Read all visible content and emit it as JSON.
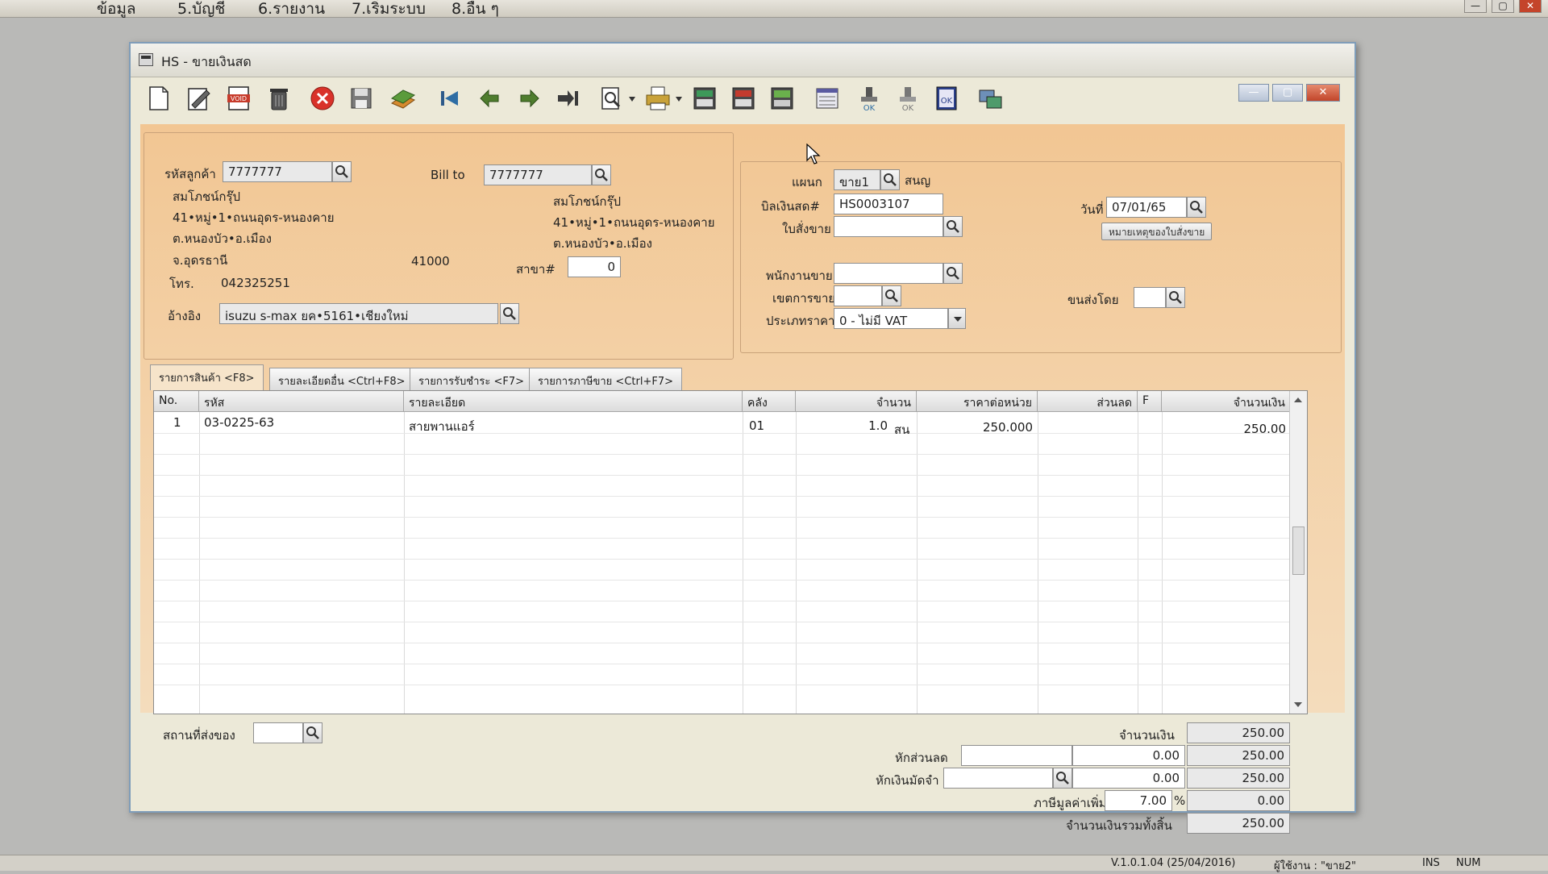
{
  "menubar": {
    "items": [
      "ข้อมูล",
      "5.บัญชี",
      "6.รายงาน",
      "7.เริ่มระบบ",
      "8.อื่น ๆ"
    ]
  },
  "window": {
    "title": "HS - ขายเงินสด"
  },
  "colors": {
    "header_bg": "#f2c693",
    "field_bg": "#ffffff",
    "close_button": "#c2452a"
  },
  "customer": {
    "code_label": "รหัสลูกค้า",
    "code": "7777777",
    "name": "สมโภชน์กรุ๊ป",
    "address1": "41•หมู่•1•ถนนอุดร-หนองคาย",
    "address2": "ต.หนองบัว•อ.เมือง",
    "province": "จ.อุดรธานี",
    "postcode": "41000",
    "phone_label": "โทร.",
    "phone": "042325251",
    "ref_label": "อ้างอิง",
    "ref": "isuzu s-max ยค•5161•เชียงใหม่"
  },
  "billto": {
    "label": "Bill to",
    "code": "7777777",
    "name": "สมโภชน์กรุ๊ป",
    "address1": "41•หมู่•1•ถนนอุดร-หนองคาย",
    "address2": "ต.หนองบัว•อ.เมือง",
    "branch_label": "สาขา#",
    "branch": "0"
  },
  "doc": {
    "dept_label": "แผนก",
    "dept": "ขาย1",
    "dept_name": "สนญ",
    "bill_label": "บิลเงินสด#",
    "bill": "HS0003107",
    "date_label": "วันที่",
    "date": "07/01/65",
    "order_label": "ใบสั่งขาย",
    "order": "",
    "order_note_button": "หมายเหตุของใบสั่งขาย",
    "salesman_label": "พนักงานขาย",
    "salesman": "",
    "area_label": "เขตการขาย",
    "area": "",
    "ship_by_label": "ขนส่งโดย",
    "ship_by": "",
    "price_type_label": "ประเภทราคา",
    "price_type": "0 - ไม่มี VAT"
  },
  "tabs": [
    {
      "label": "รายการสินค้า <F8>"
    },
    {
      "label": "รายละเอียดอื่น <Ctrl+F8>"
    },
    {
      "label": "รายการรับชำระ <F7>"
    },
    {
      "label": "รายการภาษีขาย <Ctrl+F7>"
    }
  ],
  "grid": {
    "headers": {
      "no": "No.",
      "code": "รหัส",
      "desc": "รายละเอียด",
      "wh": "คลัง",
      "qty": "จำนวน",
      "price": "ราคาต่อหน่วย",
      "disc": "ส่วนลด",
      "f": "F",
      "amount": "จำนวนเงิน"
    },
    "rows": [
      {
        "no": "1",
        "code": "03-0225-63",
        "desc": "สายพานแอร์",
        "wh": "01",
        "qty": "1.0",
        "unit": "สน",
        "price": "250.000",
        "disc": "",
        "f": "",
        "amount": "250.00"
      }
    ]
  },
  "footer": {
    "ship_place_label": "สถานที่ส่งของ",
    "ship_place": "",
    "amount_label": "จำนวนเงิน",
    "amount": "250.00",
    "discount_label": "หักส่วนลด",
    "discount_code": "",
    "discount_value": "0.00",
    "after_discount": "250.00",
    "deposit_label": "หักเงินมัดจำ",
    "deposit_code": "",
    "deposit_value": "0.00",
    "after_deposit": "250.00",
    "vat_label": "ภาษีมูลค่าเพิ่ม",
    "vat_rate": "7.00",
    "vat_pct": "%",
    "vat_amount": "0.00",
    "total_label": "จำนวนเงินรวมทั้งสิ้น",
    "total": "250.00"
  },
  "statusbar": {
    "version": "V.1.0.1.04 (25/04/2016)",
    "user": "ผู้ใช้งาน : \"ขาย2\"",
    "ins": "INS",
    "num": "NUM"
  }
}
